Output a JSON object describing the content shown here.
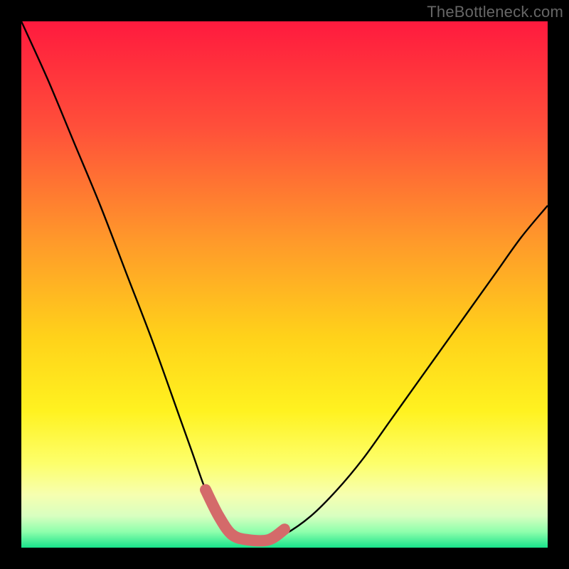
{
  "watermark": "TheBottleneck.com",
  "chart_data": {
    "type": "line",
    "title": "",
    "xlabel": "",
    "ylabel": "",
    "xlim": [
      0,
      1
    ],
    "ylim": [
      0,
      1
    ],
    "series": [
      {
        "name": "bottleneck-curve",
        "x": [
          0.0,
          0.05,
          0.1,
          0.15,
          0.2,
          0.25,
          0.3,
          0.325,
          0.35,
          0.375,
          0.4,
          0.43,
          0.47,
          0.5,
          0.55,
          0.6,
          0.65,
          0.7,
          0.75,
          0.8,
          0.85,
          0.9,
          0.95,
          1.0
        ],
        "y": [
          1.0,
          0.89,
          0.77,
          0.65,
          0.52,
          0.39,
          0.25,
          0.18,
          0.11,
          0.06,
          0.025,
          0.015,
          0.015,
          0.025,
          0.06,
          0.11,
          0.17,
          0.24,
          0.31,
          0.38,
          0.45,
          0.52,
          0.59,
          0.65
        ]
      },
      {
        "name": "trough-highlight",
        "x": [
          0.35,
          0.375,
          0.4,
          0.43,
          0.47,
          0.5
        ],
        "y": [
          0.11,
          0.06,
          0.025,
          0.015,
          0.015,
          0.035
        ]
      }
    ],
    "colors": {
      "curve": "#000000",
      "highlight": "#d46a6a",
      "gradient_stops": [
        {
          "offset": 0.0,
          "color": "#ff1a3e"
        },
        {
          "offset": 0.2,
          "color": "#ff4f3a"
        },
        {
          "offset": 0.42,
          "color": "#ff9a2a"
        },
        {
          "offset": 0.6,
          "color": "#ffd21a"
        },
        {
          "offset": 0.74,
          "color": "#fff220"
        },
        {
          "offset": 0.84,
          "color": "#fdff6b"
        },
        {
          "offset": 0.9,
          "color": "#f6ffb0"
        },
        {
          "offset": 0.94,
          "color": "#d8ffc0"
        },
        {
          "offset": 0.97,
          "color": "#8effac"
        },
        {
          "offset": 1.0,
          "color": "#18e28a"
        }
      ]
    }
  }
}
